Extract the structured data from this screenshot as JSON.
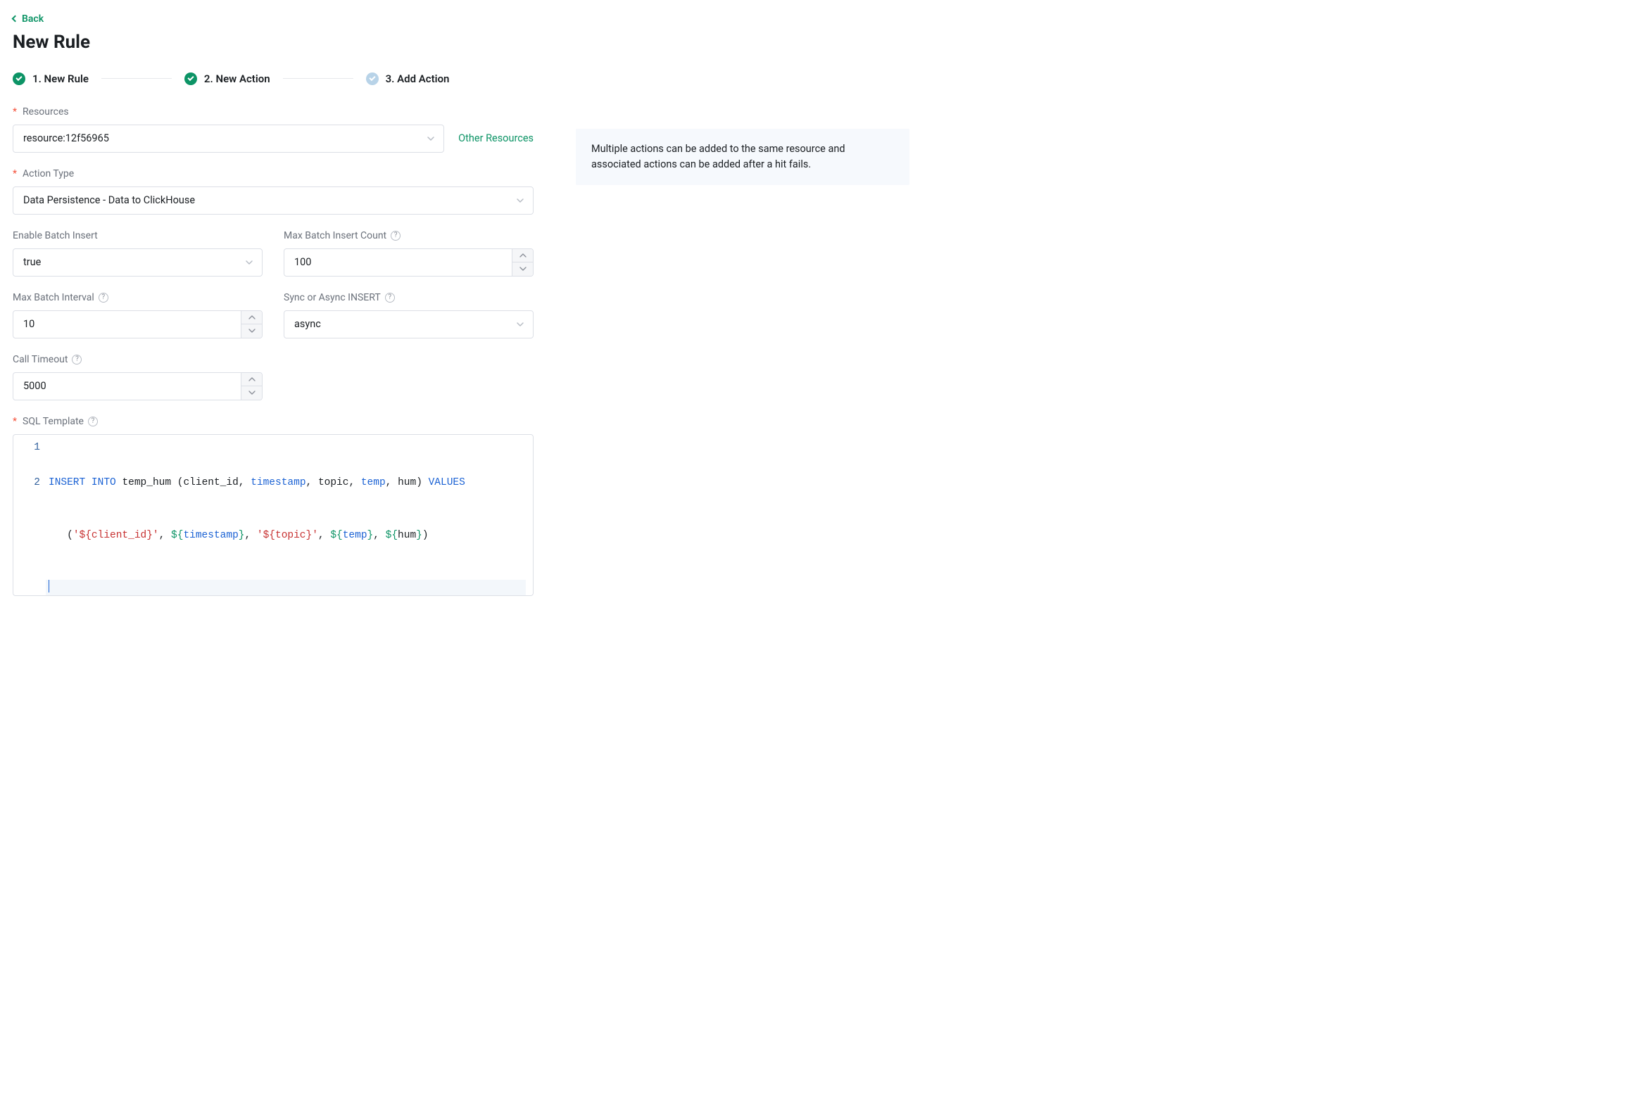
{
  "back_label": "Back",
  "page_title": "New Rule",
  "steps": [
    {
      "label": "1. New Rule",
      "state": "done"
    },
    {
      "label": "2. New Action",
      "state": "done"
    },
    {
      "label": "3. Add Action",
      "state": "pending"
    }
  ],
  "labels": {
    "resources": "Resources",
    "action_type": "Action Type",
    "enable_batch_insert": "Enable Batch Insert",
    "max_batch_insert_count": "Max Batch Insert Count",
    "max_batch_interval": "Max Batch Interval",
    "sync_async": "Sync or Async INSERT",
    "call_timeout": "Call Timeout",
    "sql_template": "SQL Template",
    "other_resources": "Other Resources"
  },
  "values": {
    "resources": "resource:12f56965",
    "action_type": "Data Persistence - Data to ClickHouse",
    "enable_batch_insert": "true",
    "max_batch_insert_count": "100",
    "max_batch_interval": "10",
    "sync_async": "async",
    "call_timeout": "5000"
  },
  "info_text": "Multiple actions can be added to the same resource and associated actions can be added after a hit fails.",
  "sql_editor": {
    "line_numbers": [
      "1",
      "2"
    ],
    "raw_text": "INSERT INTO temp_hum (client_id, timestamp, topic, temp, hum) VALUES ('${client_id}', ${timestamp}, '${topic}', ${temp}, ${hum})",
    "tokens_line1": [
      {
        "t": "INSERT",
        "c": "kw"
      },
      {
        "t": " ",
        "c": "plain"
      },
      {
        "t": "INTO",
        "c": "kw"
      },
      {
        "t": " ",
        "c": "plain"
      },
      {
        "t": "temp_hum",
        "c": "plain"
      },
      {
        "t": " (",
        "c": "plain"
      },
      {
        "t": "client_id",
        "c": "plain"
      },
      {
        "t": ", ",
        "c": "plain"
      },
      {
        "t": "timestamp",
        "c": "ident"
      },
      {
        "t": ", ",
        "c": "plain"
      },
      {
        "t": "topic",
        "c": "plain"
      },
      {
        "t": ", ",
        "c": "plain"
      },
      {
        "t": "temp",
        "c": "ident"
      },
      {
        "t": ", ",
        "c": "plain"
      },
      {
        "t": "hum",
        "c": "plain"
      },
      {
        "t": ") ",
        "c": "plain"
      },
      {
        "t": "VALUES",
        "c": "kw"
      }
    ],
    "tokens_line1b": [
      {
        "t": " (",
        "c": "plain"
      },
      {
        "t": "'${client_id}'",
        "c": "str"
      },
      {
        "t": ", ",
        "c": "plain"
      },
      {
        "t": "${",
        "c": "var"
      },
      {
        "t": "timestamp",
        "c": "ident"
      },
      {
        "t": "}",
        "c": "var"
      },
      {
        "t": ", ",
        "c": "plain"
      },
      {
        "t": "'${topic}'",
        "c": "str"
      },
      {
        "t": ", ",
        "c": "plain"
      },
      {
        "t": "${",
        "c": "var"
      },
      {
        "t": "temp",
        "c": "ident"
      },
      {
        "t": "}",
        "c": "var"
      },
      {
        "t": ", ",
        "c": "plain"
      },
      {
        "t": "${",
        "c": "var"
      },
      {
        "t": "hum",
        "c": "plain"
      },
      {
        "t": "}",
        "c": "var"
      },
      {
        "t": ")",
        "c": "plain"
      }
    ]
  }
}
